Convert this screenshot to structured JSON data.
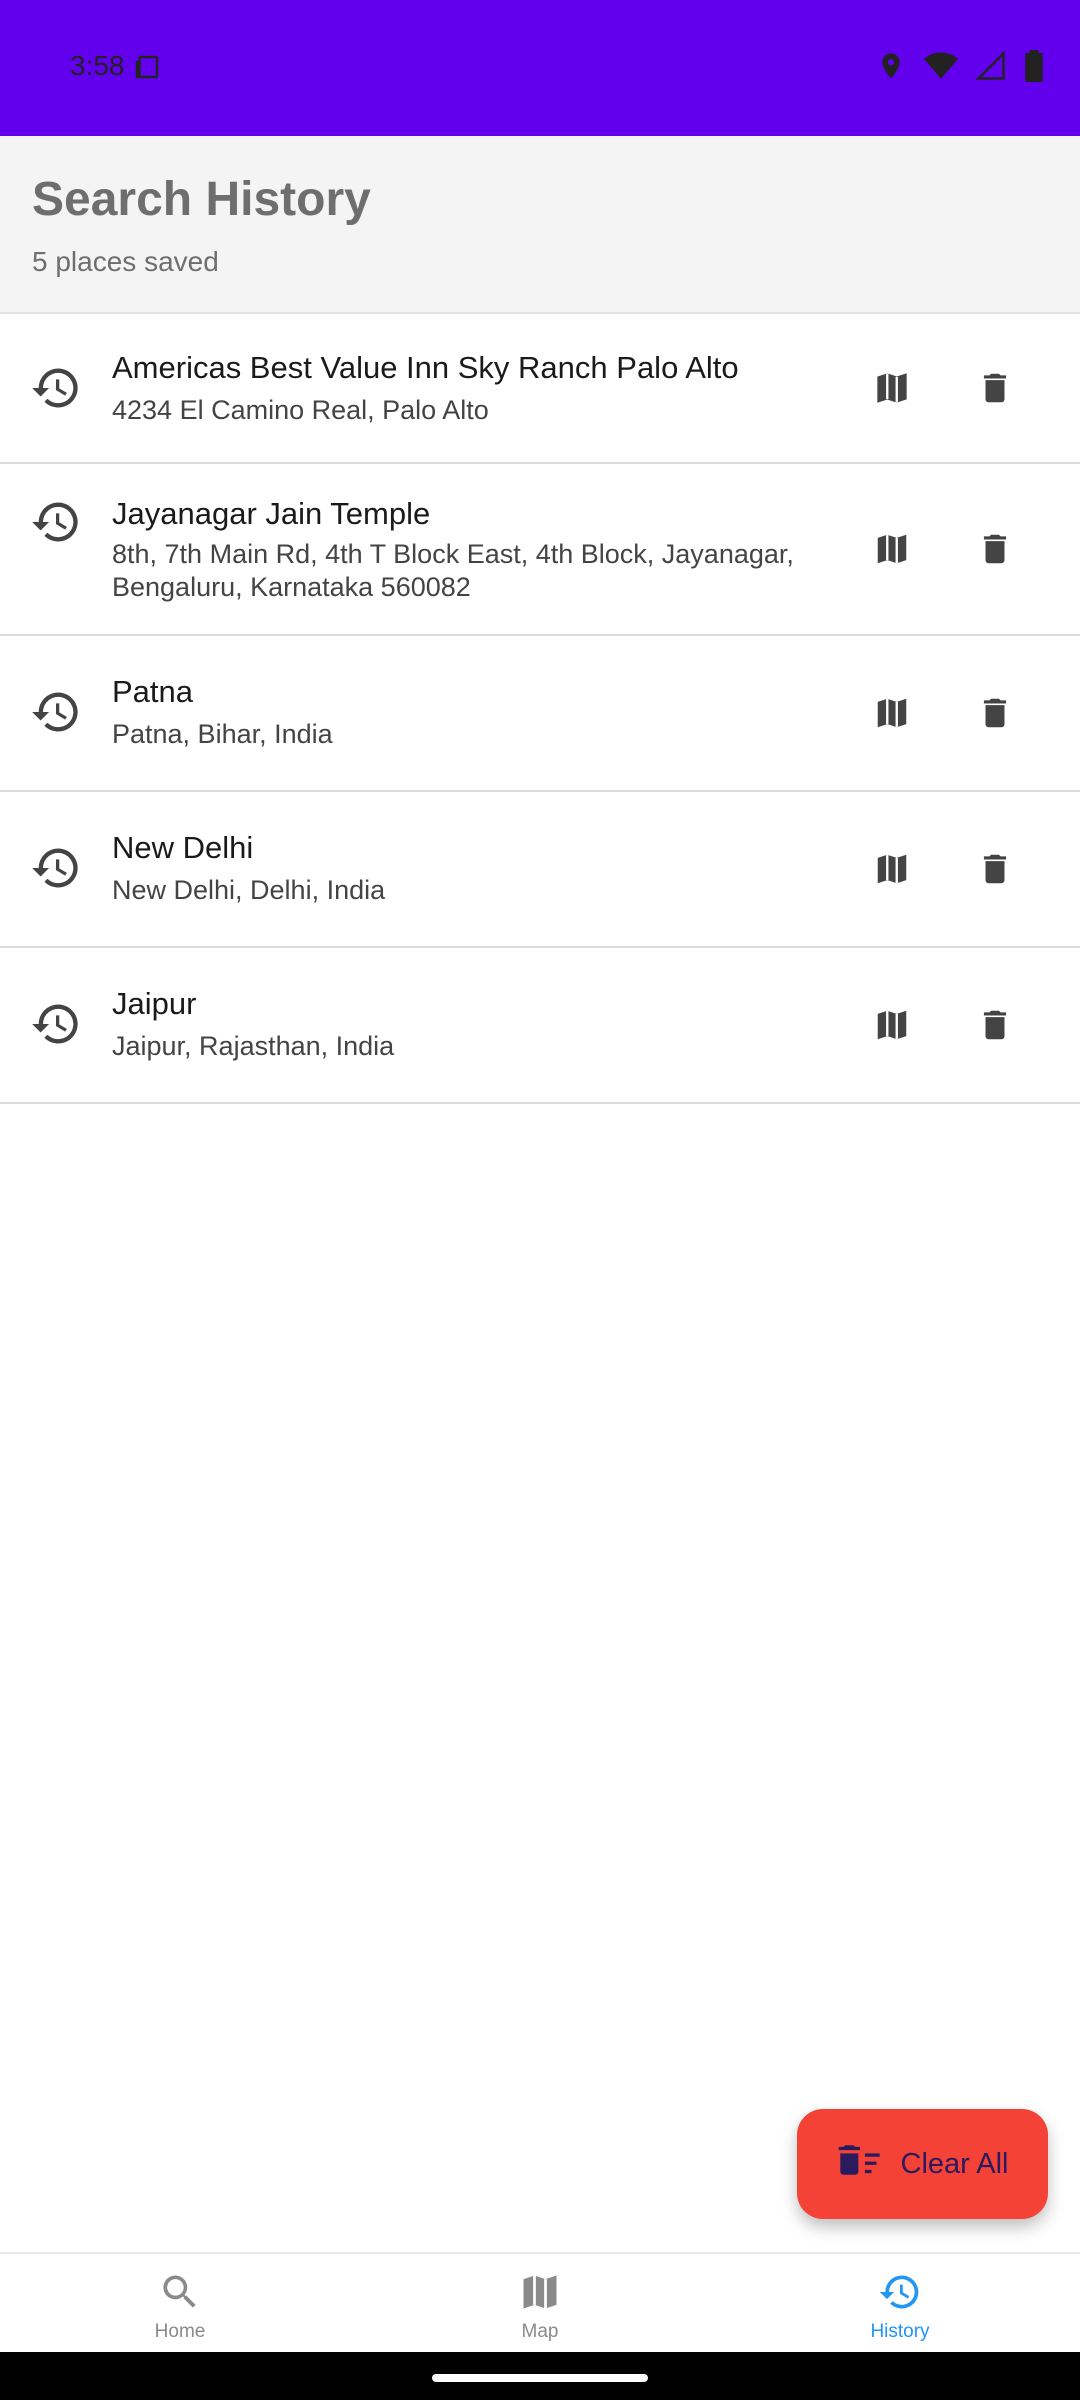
{
  "status_bar": {
    "time": "3:58"
  },
  "header": {
    "title": "Search History",
    "subtitle": "5 places saved"
  },
  "history": [
    {
      "name": "Americas Best Value Inn Sky Ranch Palo Alto",
      "address": "4234 El Camino Real, Palo Alto"
    },
    {
      "name": "Jayanagar Jain Temple",
      "address": "8th, 7th Main Rd, 4th T Block East, 4th Block, Jayanagar, Bengaluru, Karnataka 560082"
    },
    {
      "name": "Patna",
      "address": "Patna, Bihar, India"
    },
    {
      "name": "New Delhi",
      "address": "New Delhi, Delhi, India"
    },
    {
      "name": "Jaipur",
      "address": "Jaipur, Rajasthan, India"
    }
  ],
  "fab": {
    "label": "Clear All"
  },
  "bottom_nav": {
    "items": [
      {
        "label": "Home",
        "icon": "search-icon",
        "active": false
      },
      {
        "label": "Map",
        "icon": "map-icon",
        "active": false
      },
      {
        "label": "History",
        "icon": "history-icon",
        "active": true
      }
    ]
  },
  "colors": {
    "status_bar": "#6200ee",
    "fab": "#f44336",
    "nav_active": "#2196f3",
    "nav_inactive": "#8a8a8a"
  }
}
